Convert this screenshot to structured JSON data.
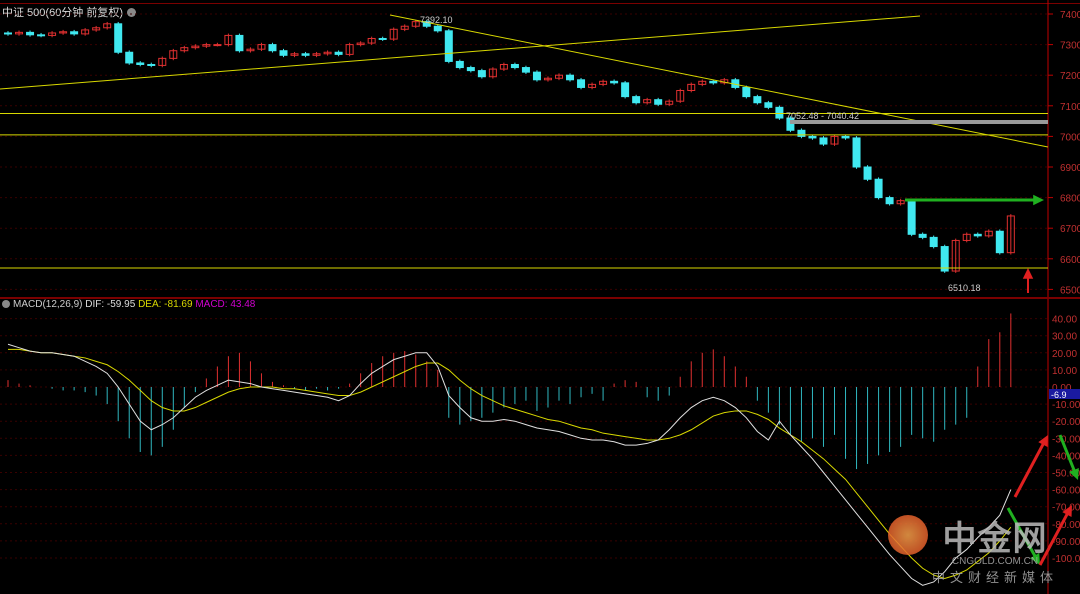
{
  "header": {
    "title": "中证 500(60分钟 前复权)"
  },
  "macd_header": {
    "name": "MACD(12,26,9)",
    "dif": "DIF: -59.95",
    "dea": "DEA: -81.69",
    "macd": "MACD: 43.48"
  },
  "annotations": {
    "high": "7392.10",
    "gap": "7052.48 - 7040.42",
    "low": "6510.18",
    "macd_current": "-6.9"
  },
  "logo": {
    "cn": "中金网",
    "en": "CNGOLD.COM.CN",
    "sub": "中文财经新媒体"
  },
  "colors": {
    "up": "#e03030",
    "down": "#40e8f0",
    "dif": "#e0e0e0",
    "dea": "#d8d800",
    "trend": "#d8d800",
    "axis": "#c00000"
  },
  "chart_data": [
    {
      "type": "candlestick",
      "title": "中证 500(60分钟 前复权)",
      "ylim": [
        6470,
        7420
      ],
      "yticks": [
        7400,
        7300,
        7200,
        7100,
        7000,
        6900,
        6800,
        6700,
        6600,
        6500
      ],
      "closes": [
        7335,
        7340,
        7332,
        7330,
        7338,
        7342,
        7335,
        7348,
        7355,
        7368,
        7275,
        7240,
        7235,
        7232,
        7255,
        7280,
        7290,
        7295,
        7300,
        7300,
        7330,
        7280,
        7285,
        7300,
        7280,
        7265,
        7270,
        7265,
        7270,
        7275,
        7268,
        7300,
        7305,
        7320,
        7318,
        7350,
        7360,
        7375,
        7360,
        7345,
        7245,
        7225,
        7215,
        7195,
        7220,
        7235,
        7225,
        7210,
        7185,
        7190,
        7200,
        7185,
        7160,
        7170,
        7180,
        7175,
        7130,
        7110,
        7120,
        7105,
        7115,
        7150,
        7170,
        7180,
        7175,
        7185,
        7160,
        7130,
        7110,
        7095,
        7060,
        7020,
        7000,
        6995,
        6975,
        7000,
        6995,
        6900,
        6860,
        6800,
        6780,
        6790,
        6680,
        6670,
        6640,
        6560,
        6660,
        6680,
        6675,
        6690,
        6620,
        6740
      ],
      "horizontal_levels": [
        7075,
        7005,
        6570
      ],
      "gap_band": [
        7052.48,
        7040.42
      ]
    },
    {
      "type": "macd",
      "ylim": [
        -110,
        50
      ],
      "yticks": [
        40,
        30,
        20,
        10,
        0,
        -10,
        -20,
        -30,
        -40,
        -50,
        -60,
        -70,
        -80,
        -90,
        -100
      ],
      "histogram": [
        4,
        2,
        1,
        0,
        -1,
        -2,
        -2,
        -3,
        -5,
        -10,
        -20,
        -30,
        -38,
        -40,
        -35,
        -25,
        -12,
        -3,
        5,
        12,
        18,
        20,
        15,
        8,
        3,
        1,
        -1,
        -2,
        -1,
        -2,
        -1,
        2,
        8,
        14,
        18,
        20,
        21,
        19,
        15,
        10,
        -18,
        -22,
        -20,
        -18,
        -15,
        -12,
        -10,
        -8,
        -14,
        -12,
        -8,
        -10,
        -6,
        -4,
        -8,
        2,
        4,
        3,
        -6,
        -8,
        -5,
        6,
        15,
        20,
        22,
        18,
        12,
        6,
        -8,
        -15,
        -22,
        -28,
        -32,
        -30,
        -35,
        -28,
        -42,
        -48,
        -45,
        -40,
        -38,
        -35,
        -28,
        -30,
        -32,
        -25,
        -22,
        -18,
        12,
        28,
        32,
        43
      ],
      "dif": [
        25,
        23,
        21,
        20,
        20,
        19,
        18,
        15,
        12,
        8,
        0,
        -10,
        -20,
        -25,
        -22,
        -18,
        -12,
        -6,
        -2,
        1,
        4,
        3,
        2,
        0,
        -1,
        -2,
        -3,
        -4,
        -5,
        -6,
        -8,
        -5,
        2,
        8,
        12,
        16,
        18,
        20,
        20,
        12,
        -5,
        -12,
        -18,
        -20,
        -20,
        -19,
        -20,
        -22,
        -24,
        -25,
        -26,
        -28,
        -30,
        -31,
        -31,
        -32,
        -34,
        -34,
        -33,
        -31,
        -25,
        -18,
        -12,
        -8,
        -6,
        -8,
        -12,
        -18,
        -26,
        -31,
        -20,
        -28,
        -35,
        -42,
        -50,
        -58,
        -66,
        -74,
        -82,
        -90,
        -98,
        -105,
        -112,
        -116,
        -114,
        -108,
        -100,
        -95,
        -88,
        -82,
        -75,
        -60
      ],
      "dea": [
        22,
        22,
        21,
        20,
        20,
        19,
        18,
        17,
        15,
        13,
        9,
        4,
        -2,
        -8,
        -12,
        -14,
        -14,
        -12,
        -9,
        -6,
        -3,
        -1,
        0,
        0,
        0,
        -1,
        -1,
        -2,
        -3,
        -4,
        -5,
        -5,
        -3,
        0,
        3,
        6,
        9,
        12,
        14,
        14,
        10,
        4,
        -1,
        -5,
        -8,
        -11,
        -13,
        -15,
        -17,
        -19,
        -20,
        -22,
        -24,
        -25,
        -27,
        -28,
        -29,
        -30,
        -31,
        -31,
        -30,
        -28,
        -25,
        -21,
        -17,
        -15,
        -14,
        -14,
        -16,
        -19,
        -24,
        -28,
        -32,
        -37,
        -42,
        -48,
        -54,
        -62,
        -70,
        -78,
        -86,
        -93,
        -100,
        -106,
        -110,
        -112,
        -110,
        -107,
        -102,
        -97,
        -90,
        -82
      ]
    }
  ]
}
